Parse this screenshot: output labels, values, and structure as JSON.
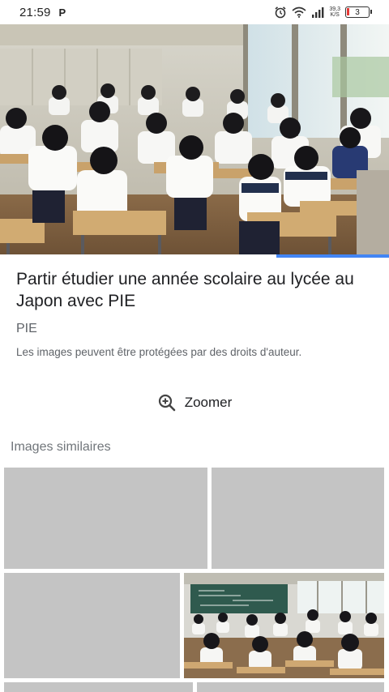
{
  "status_bar": {
    "time": "21:59",
    "notification_icon": "P",
    "speed_value": "39,3",
    "speed_unit": "K/S",
    "battery_level": "3",
    "icons": [
      "alarm-icon",
      "wifi-icon",
      "signal-icon",
      "battery-icon"
    ]
  },
  "hero_image": {
    "description_icon": "classroom-photo"
  },
  "carousel_progress": 0.29,
  "result": {
    "title": "Partir étudier une année scolaire au lycée au Japon avec PIE",
    "source": "PIE",
    "copyright_notice": "Les images peuvent être protégées par des droits d'auteur."
  },
  "zoom": {
    "label": "Zoomer",
    "icon": "zoom-in-icon"
  },
  "similar": {
    "label": "Images similaires"
  },
  "colors": {
    "accent": "#4285f4",
    "placeholder": "#c4c4c4",
    "text_primary": "#202124",
    "text_secondary": "#5f6368"
  }
}
